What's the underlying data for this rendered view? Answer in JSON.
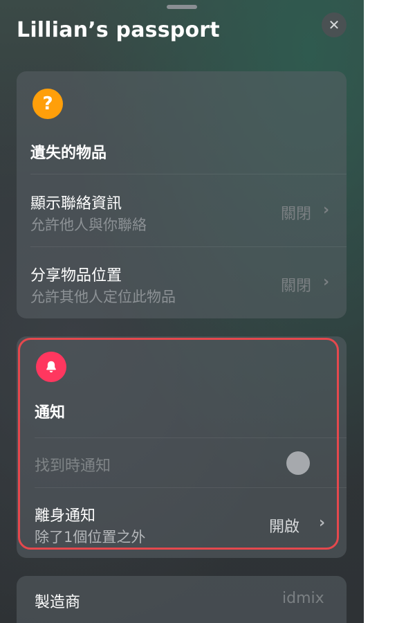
{
  "sheet": {
    "title": "Lillian’s passport",
    "close_icon": "✕"
  },
  "lost_section": {
    "icon_glyph": "?",
    "title": "遺失的物品",
    "rows": [
      {
        "label": "顯示聯絡資訊",
        "sublabel": "允許他人與你聯絡",
        "value": "關閉"
      },
      {
        "label": "分享物品位置",
        "sublabel": "允許其他人定位此物品",
        "value": "關閉"
      }
    ]
  },
  "notify_section": {
    "title": "通知",
    "found_row": {
      "label": "找到時通知",
      "toggle_on": false
    },
    "leave_row": {
      "label": "離身通知",
      "sublabel": "除了1個位置之外",
      "value": "開啟"
    }
  },
  "info_section": {
    "rows": [
      {
        "label": "製造商",
        "value": "idmix"
      }
    ]
  },
  "colors": {
    "accent_orange": "#ff9f0a",
    "accent_pink": "#ff375f",
    "highlight_red": "#e5484d"
  }
}
